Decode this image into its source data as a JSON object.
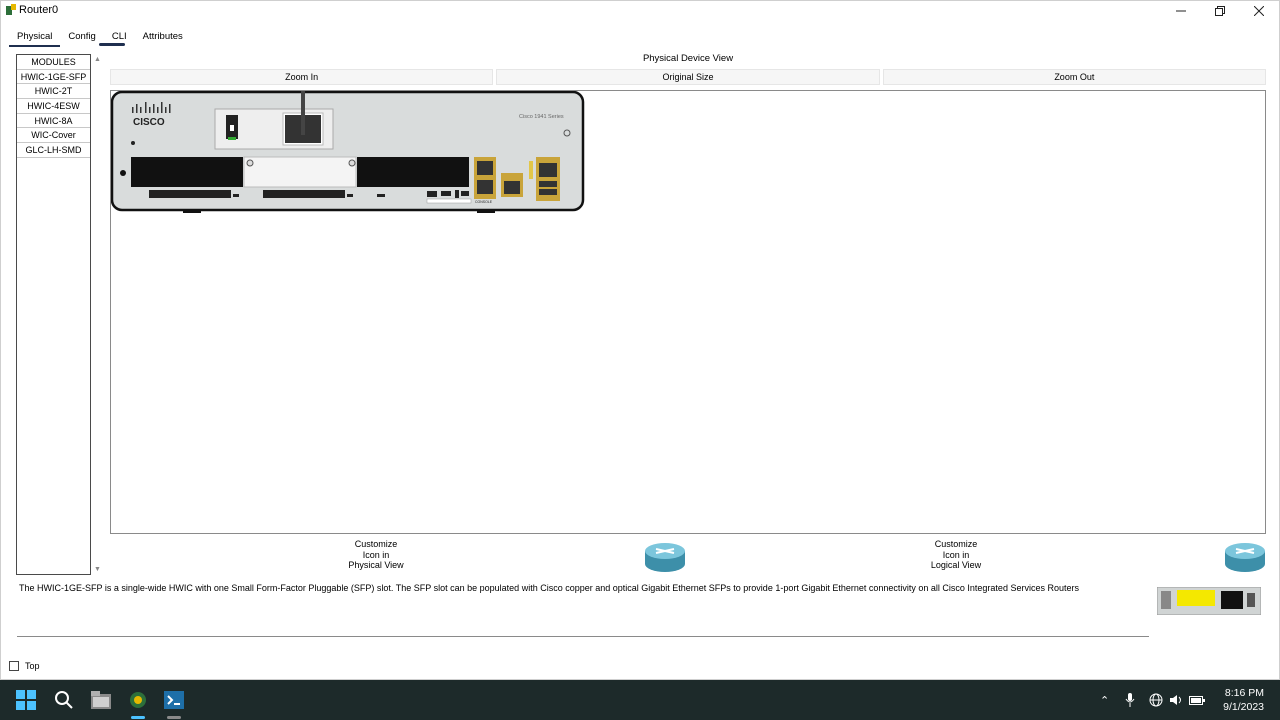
{
  "window": {
    "title": "Router0"
  },
  "tabs": [
    {
      "label": "Physical"
    },
    {
      "label": "Config"
    },
    {
      "label": "CLI"
    },
    {
      "label": "Attributes"
    }
  ],
  "modules": {
    "items": [
      "MODULES",
      "HWIC-1GE-SFP",
      "HWIC-2T",
      "HWIC-4ESW",
      "HWIC-8A",
      "WIC-Cover",
      "GLC-LH-SMD"
    ]
  },
  "physical_view": {
    "title": "Physical Device View",
    "zoom_in": "Zoom In",
    "original_size": "Original Size",
    "zoom_out": "Zoom Out",
    "router_model_label": "Cisco 1941 Series",
    "router_brand": "CISCO",
    "console_label": "CONSOLE"
  },
  "customize": {
    "physical": {
      "line1": "Customize",
      "line2": "Icon in",
      "line3": "Physical View"
    },
    "logical": {
      "line1": "Customize",
      "line2": "Icon in",
      "line3": "Logical View"
    }
  },
  "description": "The HWIC-1GE-SFP is a single-wide HWIC with one Small Form-Factor Pluggable (SFP) slot. The SFP slot can be populated with Cisco copper and optical Gigabit Ethernet SFPs to provide 1-port Gigabit Ethernet connectivity on all Cisco Integrated Services Routers",
  "top_checkbox": {
    "label": "Top",
    "checked": false
  },
  "taskbar": {
    "time": "8:16 PM",
    "date": "9/1/2023",
    "icons": [
      "windows-start-icon",
      "search-icon",
      "file-explorer-icon",
      "packet-tracer-icon",
      "terminal-app-icon"
    ]
  },
  "colors": {
    "tab_underline": "#1f2f4f",
    "taskbar_bg": "#1d2a2a",
    "router_body": "#d9dcdc",
    "router_icon": "#5fb0c9"
  }
}
